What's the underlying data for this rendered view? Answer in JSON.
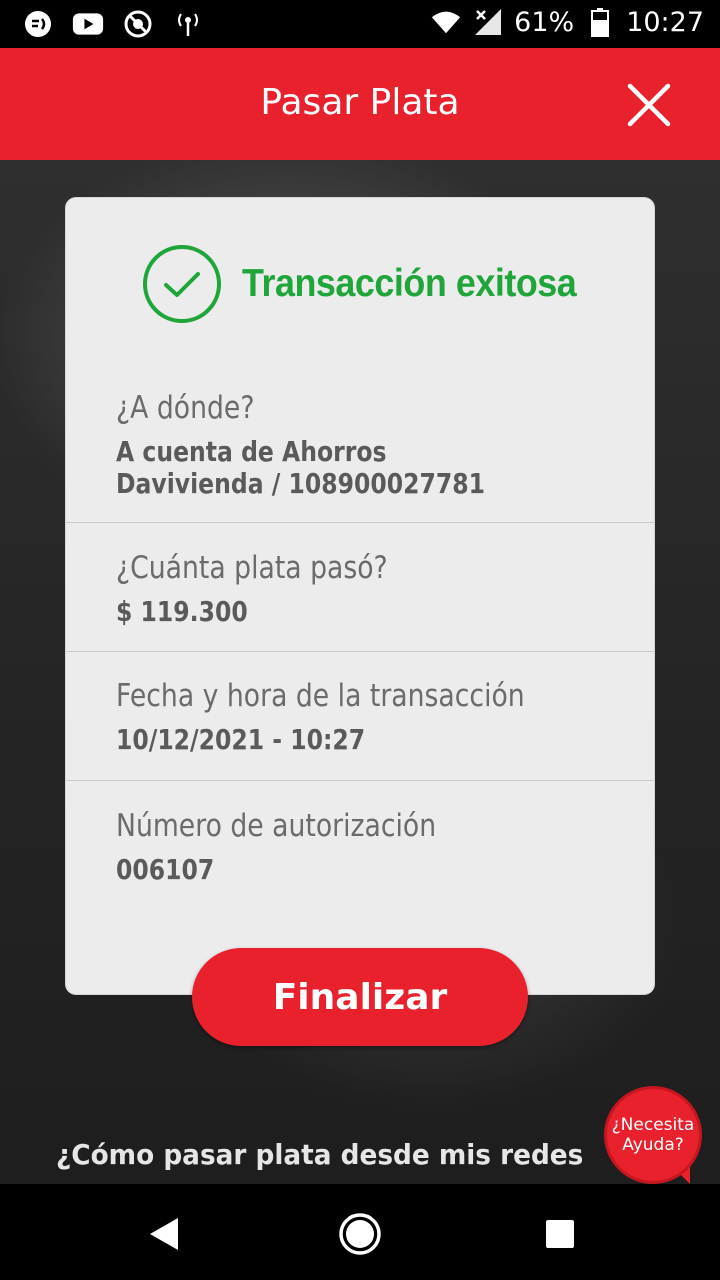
{
  "status_bar": {
    "battery": "61%",
    "time": "10:27"
  },
  "header": {
    "title": "Pasar Plata"
  },
  "card": {
    "success_text": "Transacción exitosa",
    "sections": [
      {
        "label": "¿A dónde?",
        "value": "A cuenta de Ahorros Davivienda / 108900027781"
      },
      {
        "label": "¿Cuánta plata pasó?",
        "value": "$ 119.300"
      },
      {
        "label": "Fecha y hora de la transacción",
        "value": "10/12/2021 - 10:27"
      },
      {
        "label": "Número de autorización",
        "value": "006107"
      }
    ]
  },
  "actions": {
    "finalize_label": "Finalizar"
  },
  "footer": {
    "help_link": "¿Cómo pasar plata desde mis redes sociales?",
    "help_bubble_line1": "¿Necesita",
    "help_bubble_line2": "Ayuda?"
  },
  "colors": {
    "brand_red": "#e8212c",
    "success_green": "#1fa53a"
  }
}
